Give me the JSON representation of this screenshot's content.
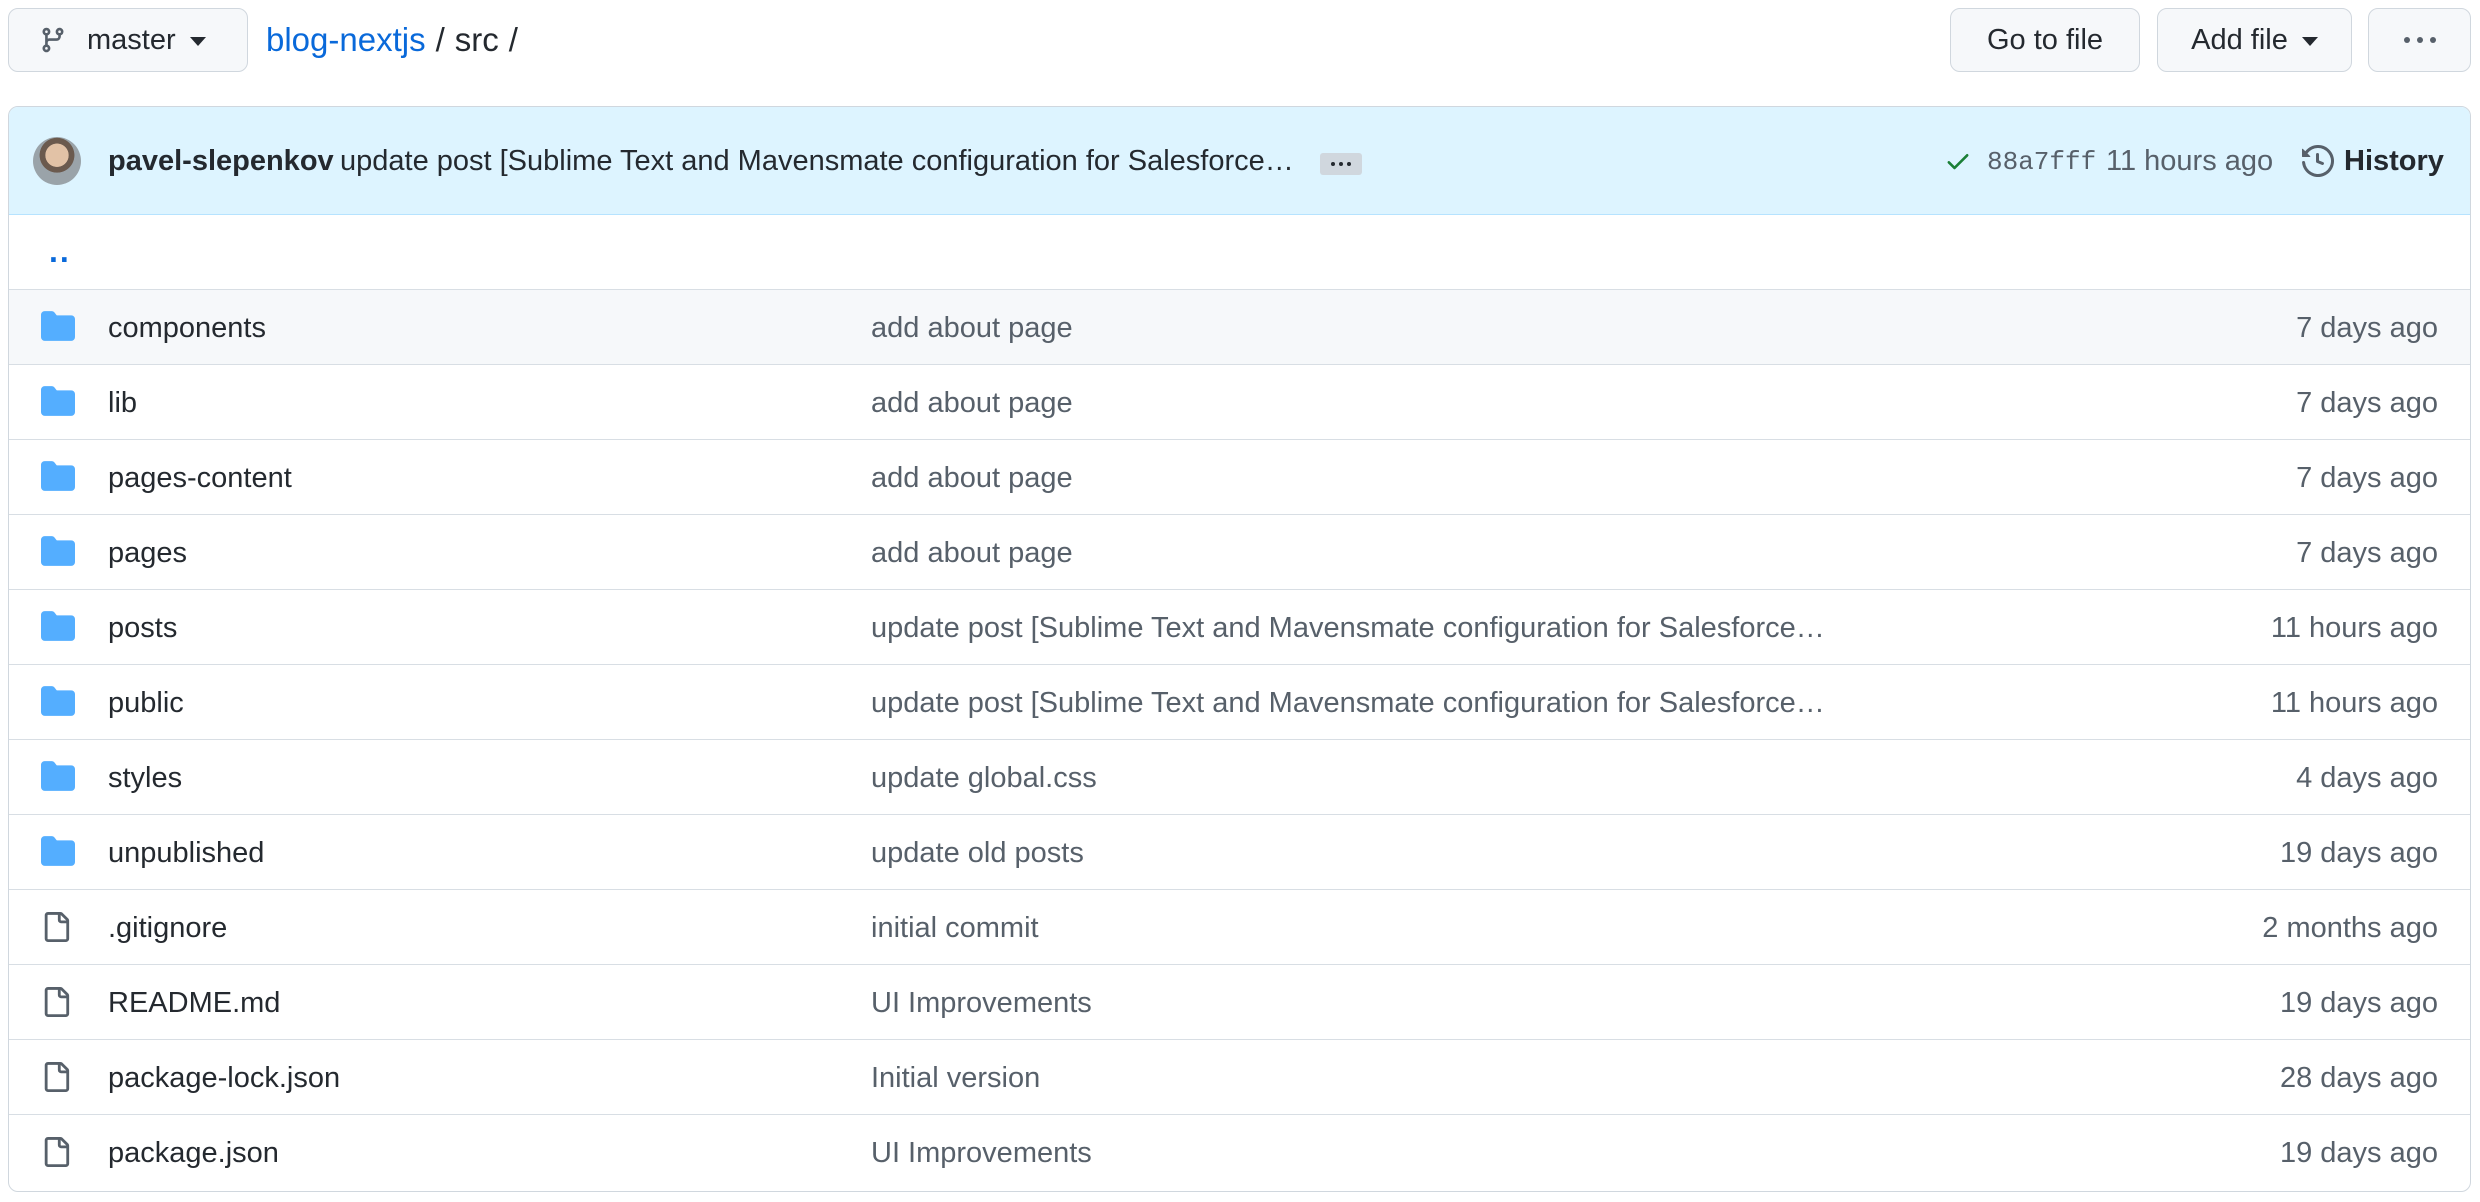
{
  "branch": {
    "name": "master",
    "icon": "git-branch-icon"
  },
  "breadcrumb": {
    "repo": "blog-nextjs",
    "separator": "/",
    "dir": "src",
    "trailing": "/"
  },
  "actions": {
    "goto_file": "Go to file",
    "add_file": "Add file",
    "more": "more-options-icon"
  },
  "latest_commit": {
    "author": "pavel-slepenkov",
    "message": "update post [Sublime Text and Mavensmate configuration for Salesforce…",
    "status_icon": "check-icon",
    "sha": "88a7fff",
    "time": "11 hours ago",
    "history_label": "History"
  },
  "parent_dir": "..",
  "colors": {
    "link": "#0969da",
    "folder": "#54aeff",
    "file_icon": "#57606a",
    "commit_bar_bg": "#ddf4ff",
    "success": "#1a7f37"
  },
  "files": [
    {
      "type": "folder",
      "name": "components",
      "message": "add about page",
      "age": "7 days ago"
    },
    {
      "type": "folder",
      "name": "lib",
      "message": "add about page",
      "age": "7 days ago"
    },
    {
      "type": "folder",
      "name": "pages-content",
      "message": "add about page",
      "age": "7 days ago"
    },
    {
      "type": "folder",
      "name": "pages",
      "message": "add about page",
      "age": "7 days ago"
    },
    {
      "type": "folder",
      "name": "posts",
      "message": "update post [Sublime Text and Mavensmate configuration for Salesforce…",
      "age": "11 hours ago"
    },
    {
      "type": "folder",
      "name": "public",
      "message": "update post [Sublime Text and Mavensmate configuration for Salesforce…",
      "age": "11 hours ago"
    },
    {
      "type": "folder",
      "name": "styles",
      "message": "update global.css",
      "age": "4 days ago"
    },
    {
      "type": "folder",
      "name": "unpublished",
      "message": "update old posts",
      "age": "19 days ago"
    },
    {
      "type": "file",
      "name": ".gitignore",
      "message": "initial commit",
      "age": "2 months ago"
    },
    {
      "type": "file",
      "name": "README.md",
      "message": "UI Improvements",
      "age": "19 days ago"
    },
    {
      "type": "file",
      "name": "package-lock.json",
      "message": "Initial version",
      "age": "28 days ago"
    },
    {
      "type": "file",
      "name": "package.json",
      "message": "UI Improvements",
      "age": "19 days ago"
    }
  ]
}
